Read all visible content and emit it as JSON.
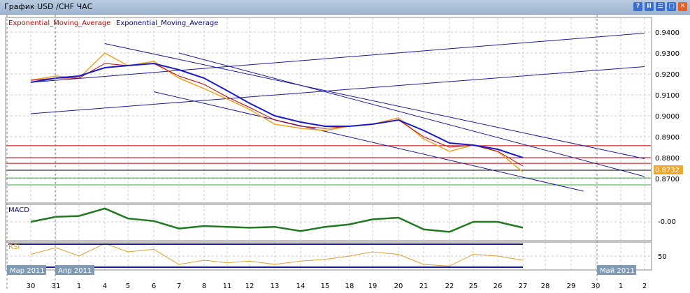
{
  "window": {
    "title": "График USD /CHF  ЧАС",
    "buttons": [
      "?",
      "II",
      "☰",
      "□",
      "✕"
    ]
  },
  "chart_data": {
    "type": "line",
    "title": "USD/CHF H1",
    "legend": [
      {
        "name": "Exponential_Moving_Average",
        "color": "#c00000"
      },
      {
        "name": "Exponential_Moving_Average",
        "color": "#00008b"
      }
    ],
    "x_ticks": [
      "30",
      "31",
      "1",
      "4",
      "5",
      "6",
      "7",
      "8",
      "11",
      "12",
      "13",
      "14",
      "15",
      "18",
      "19",
      "20",
      "21",
      "22",
      "25",
      "26",
      "27",
      "28",
      "29",
      "30",
      "1",
      "2"
    ],
    "month_labels": [
      {
        "label": "Мар 2011",
        "at": 0
      },
      {
        "label": "Апр 2011",
        "at": 2
      },
      {
        "label": "Май 2011",
        "at": 24
      }
    ],
    "y_ticks": [
      "0.9400",
      "0.9300",
      "0.9200",
      "0.9100",
      "0.9000",
      "0.8900",
      "0.8800",
      "0.8700"
    ],
    "ylim": [
      0.864,
      0.947
    ],
    "price": [
      0.917,
      0.919,
      0.918,
      0.93,
      0.924,
      0.926,
      0.918,
      0.913,
      0.908,
      0.903,
      0.896,
      0.894,
      0.893,
      0.895,
      0.896,
      0.899,
      0.889,
      0.883,
      0.886,
      0.883,
      0.8732
    ],
    "ema_blue": [
      0.916,
      0.918,
      0.919,
      0.923,
      0.924,
      0.925,
      0.922,
      0.918,
      0.912,
      0.906,
      0.9,
      0.897,
      0.895,
      0.895,
      0.896,
      0.898,
      0.893,
      0.887,
      0.886,
      0.884,
      0.88
    ],
    "ema_red": [
      0.917,
      0.918,
      0.918,
      0.925,
      0.924,
      0.925,
      0.919,
      0.915,
      0.909,
      0.904,
      0.898,
      0.895,
      0.894,
      0.895,
      0.896,
      0.898,
      0.89,
      0.885,
      0.886,
      0.883,
      0.876
    ],
    "last_price": "0.8732",
    "horizontal_levels": [
      {
        "value": 0.8857,
        "color": "#c00000"
      },
      {
        "value": 0.88,
        "color": "#c00000"
      },
      {
        "value": 0.8773,
        "color": "#c00000"
      },
      {
        "value": 0.874,
        "color": "#000000"
      },
      {
        "value": 0.8703,
        "color": "#33aa33"
      },
      {
        "value": 0.867,
        "color": "#33aa33"
      }
    ],
    "trendlines": [
      {
        "from": [
          3,
          0.9345
        ],
        "to": [
          25.5,
          0.8795
        ]
      },
      {
        "from": [
          6,
          0.93
        ],
        "to": [
          25.5,
          0.871
        ]
      },
      {
        "from": [
          5,
          0.9115
        ],
        "to": [
          22.5,
          0.864
        ]
      },
      {
        "from": [
          0,
          0.901
        ],
        "to": [
          25.5,
          0.9235
        ]
      },
      {
        "from": [
          0,
          0.916
        ],
        "to": [
          25.5,
          0.9395
        ]
      }
    ],
    "macd": {
      "label": "MACD",
      "tick": "-0.00",
      "values": [
        0,
        0.6,
        0.7,
        1.6,
        0.4,
        0.1,
        -0.8,
        -0.5,
        -0.6,
        -0.7,
        -0.6,
        -1.1,
        -0.6,
        -0.3,
        0.3,
        0.5,
        -0.9,
        -1.2,
        0,
        0,
        -0.7
      ]
    },
    "rsi": {
      "label": "RSI",
      "tick": "50",
      "values": [
        52,
        60,
        50,
        65,
        55,
        58,
        40,
        45,
        42,
        44,
        40,
        44,
        46,
        50,
        55,
        52,
        40,
        38,
        52,
        50,
        45
      ]
    }
  }
}
